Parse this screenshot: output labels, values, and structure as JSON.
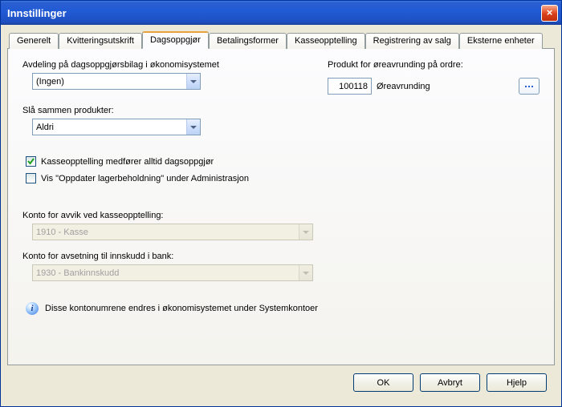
{
  "window": {
    "title": "Innstillinger"
  },
  "tabs": [
    {
      "label": "Generelt"
    },
    {
      "label": "Kvitteringsutskrift"
    },
    {
      "label": "Dagsoppgjør",
      "active": true
    },
    {
      "label": "Betalingsformer"
    },
    {
      "label": "Kasseopptelling"
    },
    {
      "label": "Registrering av salg"
    },
    {
      "label": "Eksterne enheter"
    }
  ],
  "dept": {
    "label": "Avdeling på dagsoppgjørsbilag i økonomisystemet",
    "value": "(Ingen)"
  },
  "product": {
    "label": "Produkt for øreavrunding på ordre:",
    "value": "100118",
    "name": "Øreavrunding"
  },
  "merge": {
    "label": "Slå sammen produkter:",
    "value": "Aldri"
  },
  "checks": {
    "cashcount": {
      "label": "Kasseopptelling medfører alltid dagsoppgjør",
      "checked": true
    },
    "updatestock": {
      "label": "Vis \"Oppdater lagerbeholdning\" under Administrasjon",
      "checked": false
    }
  },
  "accounts": {
    "deviation": {
      "label": "Konto for avvik ved kasseopptelling:",
      "value": "1910 - Kasse"
    },
    "deposit": {
      "label": "Konto for avsetning til innskudd i bank:",
      "value": "1930 - Bankinnskudd"
    }
  },
  "info_text": "Disse kontonumrene endres i økonomisystemet under Systemkontoer",
  "buttons": {
    "ok": "OK",
    "cancel": "Avbryt",
    "help": "Hjelp"
  }
}
